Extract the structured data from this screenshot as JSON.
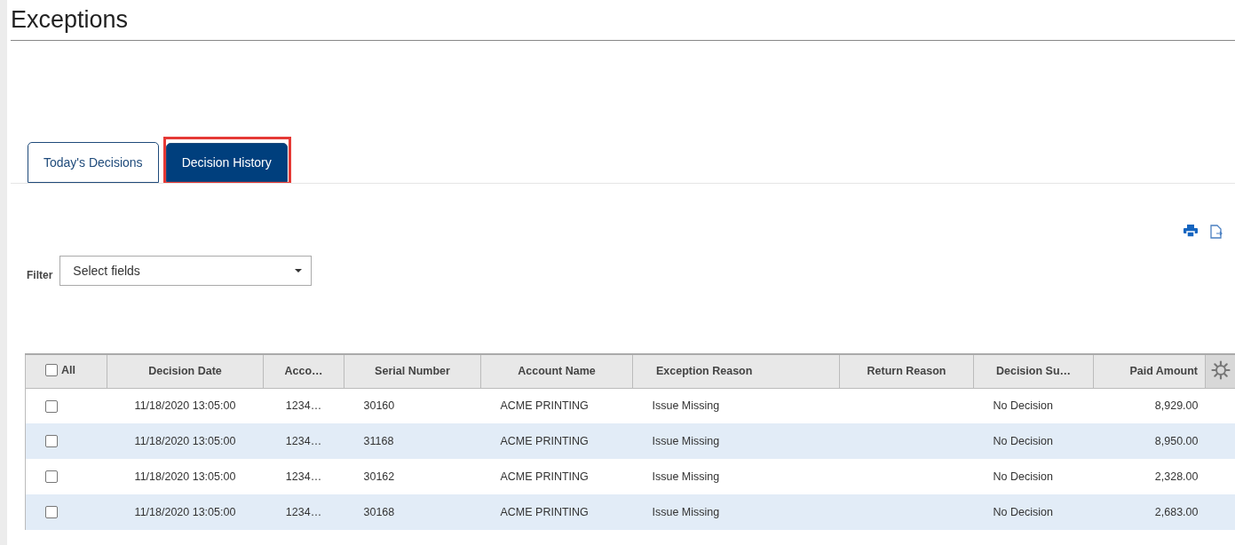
{
  "page": {
    "title": "Exceptions"
  },
  "tabs": [
    {
      "label": "Today's Decisions",
      "selected": false,
      "highlighted": false
    },
    {
      "label": "Decision History",
      "selected": true,
      "highlighted": true
    }
  ],
  "filter": {
    "label": "Filter",
    "placeholder": "Select fields"
  },
  "table": {
    "select_all": {
      "label": "All",
      "checked": false
    },
    "columns": [
      "Decision Date",
      "Acco…",
      "Serial Number",
      "Account Name",
      "Exception Reason",
      "Return Reason",
      "Decision Su…",
      "Paid Amount"
    ],
    "rows": [
      {
        "checked": false,
        "cells": [
          "11/18/2020 13:05:00",
          "1234…",
          "30160",
          "ACME PRINTING",
          "Issue Missing",
          "",
          "No Decision",
          "8,929.00"
        ]
      },
      {
        "checked": false,
        "cells": [
          "11/18/2020 13:05:00",
          "1234…",
          "31168",
          "ACME PRINTING",
          "Issue Missing",
          "",
          "No Decision",
          "8,950.00"
        ]
      },
      {
        "checked": false,
        "cells": [
          "11/18/2020 13:05:00",
          "1234…",
          "30162",
          "ACME PRINTING",
          "Issue Missing",
          "",
          "No Decision",
          "2,328.00"
        ]
      },
      {
        "checked": false,
        "cells": [
          "11/18/2020 13:05:00",
          "1234…",
          "30168",
          "ACME PRINTING",
          "Issue Missing",
          "",
          "No Decision",
          "2,683.00"
        ]
      }
    ]
  }
}
